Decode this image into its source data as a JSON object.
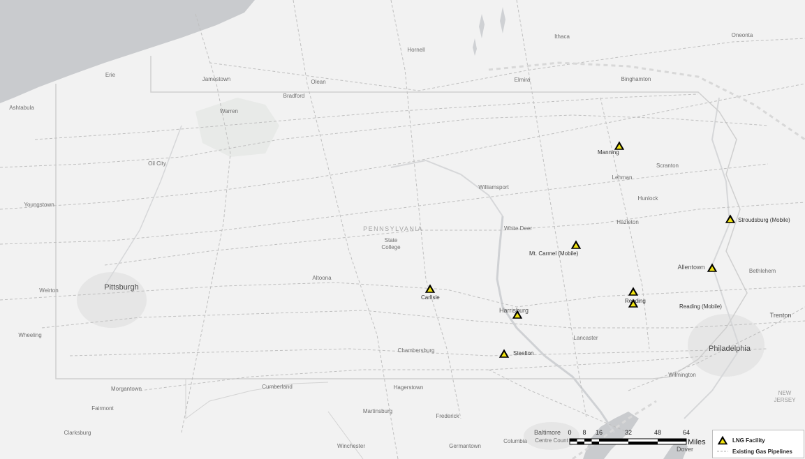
{
  "map": {
    "state_label": "PENNSYLVANIA",
    "places": [
      {
        "id": "ithaca",
        "name": "Ithaca",
        "size": "minor"
      },
      {
        "id": "oneonta",
        "name": "Oneonta",
        "size": "minor"
      },
      {
        "id": "hornell",
        "name": "Hornell",
        "size": "minor"
      },
      {
        "id": "erie",
        "name": "Erie",
        "size": "minor"
      },
      {
        "id": "jamestown",
        "name": "Jamestown",
        "size": "minor"
      },
      {
        "id": "olean",
        "name": "Olean",
        "size": "minor"
      },
      {
        "id": "elmira",
        "name": "Elmira",
        "size": "minor"
      },
      {
        "id": "binghamton",
        "name": "Binghamton",
        "size": "minor"
      },
      {
        "id": "bradford",
        "name": "Bradford",
        "size": "minor"
      },
      {
        "id": "ashtabula",
        "name": "Ashtabula",
        "size": "minor"
      },
      {
        "id": "warren",
        "name": "Warren",
        "size": "minor"
      },
      {
        "id": "scranton",
        "name": "Scranton",
        "size": "minor"
      },
      {
        "id": "oil-city",
        "name": "Oil City",
        "size": "minor"
      },
      {
        "id": "lehman",
        "name": "Lehman",
        "size": "minor"
      },
      {
        "id": "williamsport",
        "name": "Williamsport",
        "size": "minor"
      },
      {
        "id": "hunlock",
        "name": "Hunlock",
        "size": "minor"
      },
      {
        "id": "youngstown",
        "name": "Youngstown",
        "size": "minor"
      },
      {
        "id": "hazleton",
        "name": "Hazleton",
        "size": "minor"
      },
      {
        "id": "white-deer",
        "name": "White Deer",
        "size": "minor"
      },
      {
        "id": "state-college",
        "name": "State\nCollege",
        "size": "minor"
      },
      {
        "id": "allentown",
        "name": "Allentown",
        "size": "medium"
      },
      {
        "id": "bethlehem",
        "name": "Bethlehem",
        "size": "minor"
      },
      {
        "id": "altoona",
        "name": "Altoona",
        "size": "minor"
      },
      {
        "id": "pittsburgh",
        "name": "Pittsburgh",
        "size": "major"
      },
      {
        "id": "weirton",
        "name": "Weirton",
        "size": "minor"
      },
      {
        "id": "harrisburg",
        "name": "Harrisburg",
        "size": "medium"
      },
      {
        "id": "trenton",
        "name": "Trenton",
        "size": "medium"
      },
      {
        "id": "wheeling",
        "name": "Wheeling",
        "size": "minor"
      },
      {
        "id": "lancaster",
        "name": "Lancaster",
        "size": "minor"
      },
      {
        "id": "philadelphia",
        "name": "Philadelphia",
        "size": "major"
      },
      {
        "id": "chambersburg",
        "name": "Chambersburg",
        "size": "minor"
      },
      {
        "id": "wilmington",
        "name": "Wilmington",
        "size": "minor"
      },
      {
        "id": "morgantown",
        "name": "Morgantown",
        "size": "minor"
      },
      {
        "id": "cumberland",
        "name": "Cumberland",
        "size": "minor"
      },
      {
        "id": "hagerstown",
        "name": "Hagerstown",
        "size": "minor"
      },
      {
        "id": "new-jersey",
        "name": "NEW\nJERSEY",
        "size": "state-faint"
      },
      {
        "id": "fairmont",
        "name": "Fairmont",
        "size": "minor"
      },
      {
        "id": "martinsburg",
        "name": "Martinsburg",
        "size": "minor"
      },
      {
        "id": "frederick",
        "name": "Frederick",
        "size": "minor"
      },
      {
        "id": "baltimore",
        "name": "Baltimore",
        "size": "medium"
      },
      {
        "id": "clarksburg",
        "name": "Clarksburg",
        "size": "minor"
      },
      {
        "id": "centre-count",
        "name": "Centre Count",
        "size": "minor"
      },
      {
        "id": "winchester",
        "name": "Winchester",
        "size": "minor"
      },
      {
        "id": "germantown",
        "name": "Germantown",
        "size": "minor"
      },
      {
        "id": "columbia",
        "name": "Columbia",
        "size": "minor"
      },
      {
        "id": "dover",
        "name": "Dover",
        "size": "medium"
      }
    ],
    "facilities": [
      {
        "id": "manning",
        "name": "Manning"
      },
      {
        "id": "stroudsburg",
        "name": "Stroudsburg (Mobile)"
      },
      {
        "id": "mt-carmel",
        "name": "Mt. Carmel (Mobile)"
      },
      {
        "id": "allentown-fac",
        "name": ""
      },
      {
        "id": "carlisle",
        "name": "Carlisle"
      },
      {
        "id": "reading",
        "name": "Reading"
      },
      {
        "id": "reading-2",
        "name": ""
      },
      {
        "id": "reading-mobile",
        "name": "Reading (Mobile)"
      },
      {
        "id": "harrisburg-fac",
        "name": ""
      },
      {
        "id": "steelton",
        "name": "Steelton"
      }
    ]
  },
  "scale_bar": {
    "ticks": [
      "0",
      "8",
      "16",
      "32",
      "48",
      "64"
    ],
    "unit": "Miles"
  },
  "legend": {
    "items": [
      {
        "label": "LNG Facility",
        "icon": "triangle-marker-icon"
      },
      {
        "label": "Existing Gas Pipelines",
        "icon": "dashed-line-icon"
      }
    ]
  },
  "colors": {
    "facility_fill": "#000000",
    "facility_inner": "#f2e40f",
    "water": "#c9cbce",
    "land": "#f2f2f2",
    "pipeline": "#bfbfbf"
  }
}
